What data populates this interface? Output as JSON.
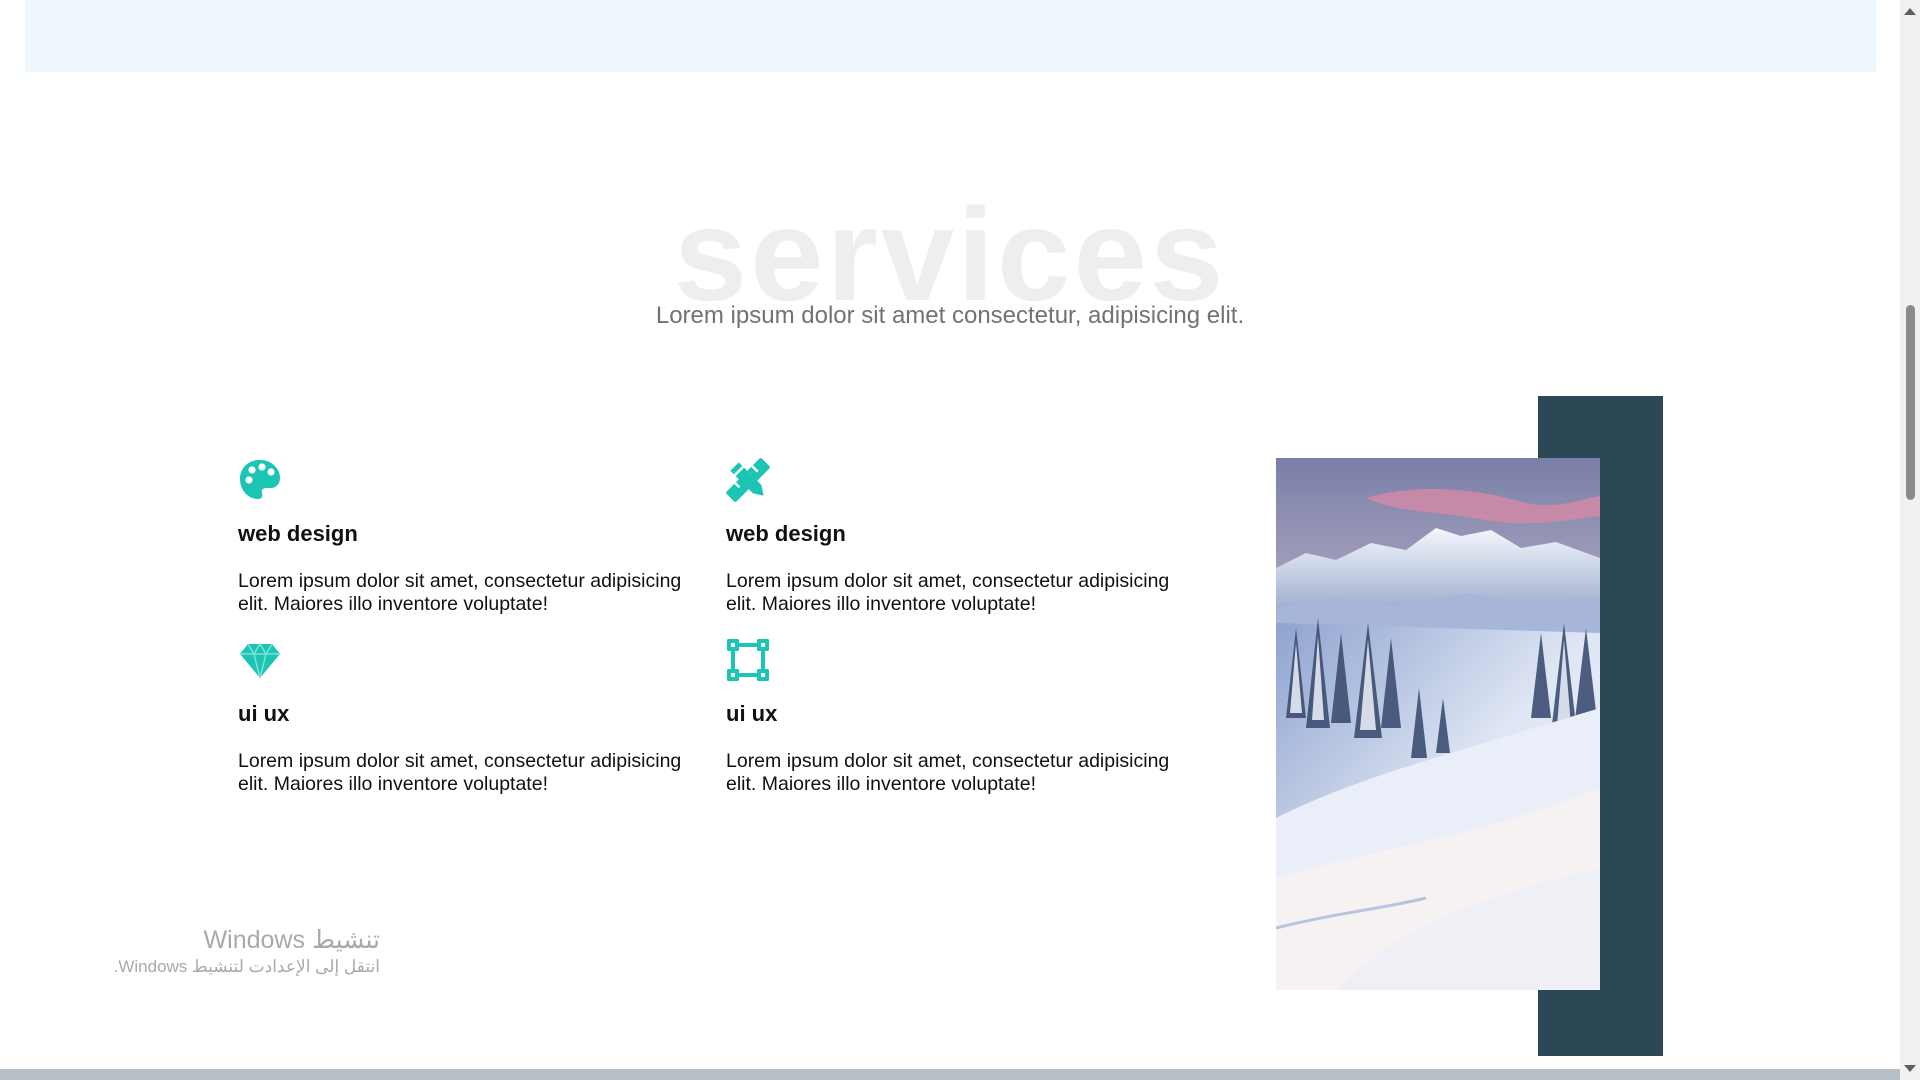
{
  "services": {
    "title": "services",
    "subtitle": "Lorem ipsum dolor sit amet consectetur, adipisicing elit.",
    "cards": [
      {
        "icon": "palette-icon",
        "title": "web design",
        "text": "Lorem ipsum dolor sit amet, consectetur adipisicing elit. Maiores illo inventore voluptate!"
      },
      {
        "icon": "pencil-ruler-icon",
        "title": "web design",
        "text": "Lorem ipsum dolor sit amet, consectetur adipisicing elit. Maiores illo inventore voluptate!"
      },
      {
        "icon": "gem-icon",
        "title": "ui ux",
        "text": "Lorem ipsum dolor sit amet, consectetur adipisicing elit. Maiores illo inventore voluptate!"
      },
      {
        "icon": "vector-square-icon",
        "title": "ui ux",
        "text": "Lorem ipsum dolor sit amet, consectetur adipisicing elit. Maiores illo inventore voluptate!"
      }
    ],
    "image": "snowy-mountain-landscape"
  },
  "watermark": {
    "title": "تنشيط Windows",
    "subtitle": "انتقل إلى الإعدادت لتنشيط Windows."
  },
  "colors": {
    "accent": "#1cc4b4",
    "dark_block": "#2c4756",
    "title_watermark": "#eceeef",
    "top_band": "#eef6fe"
  }
}
